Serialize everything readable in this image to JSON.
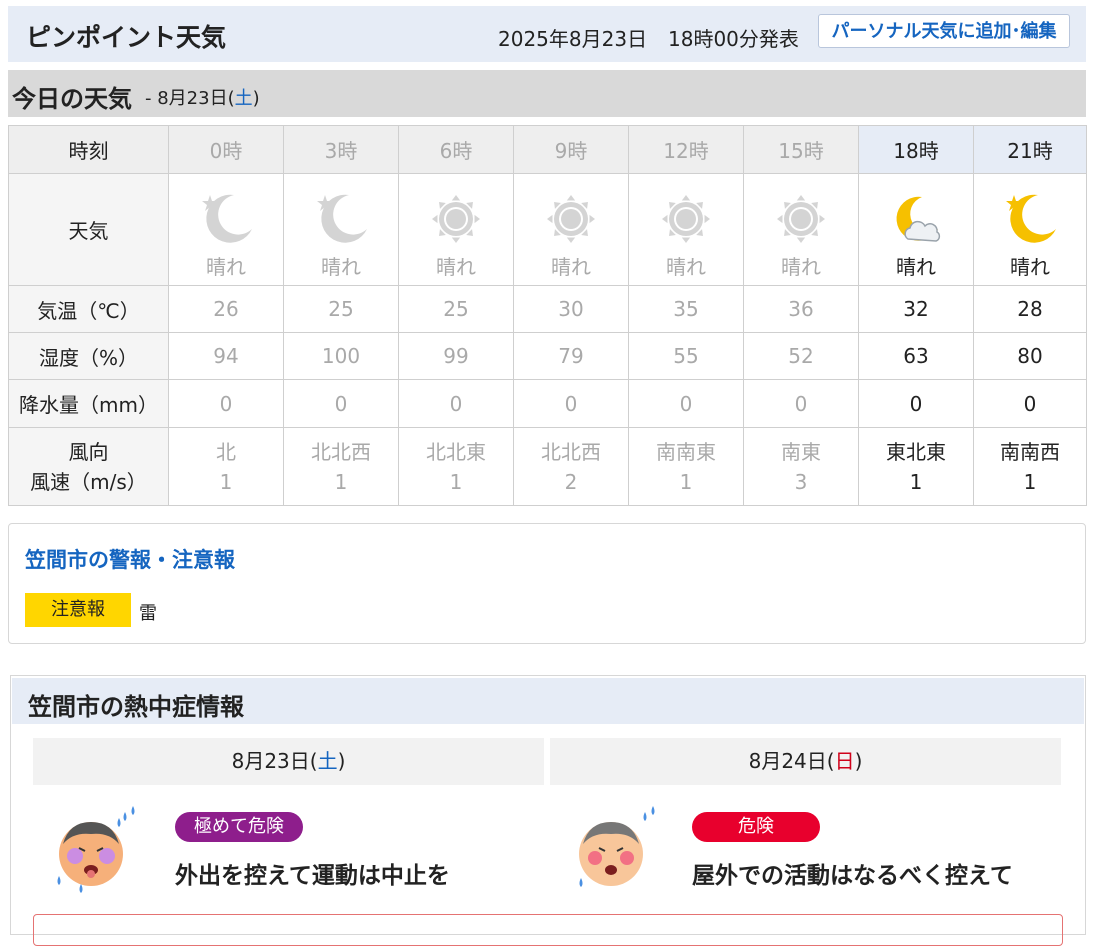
{
  "header": {
    "title": "ピンポイント天気",
    "issued_date": "2025年8月23日",
    "issued_time": "18時00分発表",
    "add_button": "パーソナル天気に追加･編集"
  },
  "today": {
    "title": "今日の天気",
    "date_prefix": "- 8月23日(",
    "weekday": "土",
    "date_suffix": ")"
  },
  "forecast": {
    "row_labels": {
      "time": "時刻",
      "weather": "天気",
      "temp": "気温（℃）",
      "humidity": "湿度（%）",
      "precip": "降水量（mm）",
      "wind_dir": "風向",
      "wind_speed": "風速（m/s）"
    },
    "hours": [
      {
        "time": "0時",
        "icon": "moon-star-icon",
        "weather": "晴れ",
        "temp": "26",
        "humidity": "94",
        "precip": "0",
        "wind_dir": "北",
        "wind_speed": "1",
        "past": true
      },
      {
        "time": "3時",
        "icon": "moon-star-icon",
        "weather": "晴れ",
        "temp": "25",
        "humidity": "100",
        "precip": "0",
        "wind_dir": "北北西",
        "wind_speed": "1",
        "past": true
      },
      {
        "time": "6時",
        "icon": "sun-icon",
        "weather": "晴れ",
        "temp": "25",
        "humidity": "99",
        "precip": "0",
        "wind_dir": "北北東",
        "wind_speed": "1",
        "past": true
      },
      {
        "time": "9時",
        "icon": "sun-icon",
        "weather": "晴れ",
        "temp": "30",
        "humidity": "79",
        "precip": "0",
        "wind_dir": "北北西",
        "wind_speed": "2",
        "past": true
      },
      {
        "time": "12時",
        "icon": "sun-icon",
        "weather": "晴れ",
        "temp": "35",
        "humidity": "55",
        "precip": "0",
        "wind_dir": "南南東",
        "wind_speed": "1",
        "past": true
      },
      {
        "time": "15時",
        "icon": "sun-icon",
        "weather": "晴れ",
        "temp": "36",
        "humidity": "52",
        "precip": "0",
        "wind_dir": "南東",
        "wind_speed": "3",
        "past": true
      },
      {
        "time": "18時",
        "icon": "moon-cloud-icon",
        "weather": "晴れ",
        "temp": "32",
        "humidity": "63",
        "precip": "0",
        "wind_dir": "東北東",
        "wind_speed": "1",
        "past": false
      },
      {
        "time": "21時",
        "icon": "moon-star-icon",
        "weather": "晴れ",
        "temp": "28",
        "humidity": "80",
        "precip": "0",
        "wind_dir": "南南西",
        "wind_speed": "1",
        "past": false
      }
    ]
  },
  "alerts": {
    "title": "笠間市の警報・注意報",
    "badge": "注意報",
    "kind": "雷",
    "badge_color": "#ffd600"
  },
  "heat": {
    "title": "笠間市の熱中症情報",
    "days": [
      {
        "date_prefix": "8月23日(",
        "weekday": "土",
        "date_suffix": ")",
        "level": "極めて危険",
        "level_color": "#8e1e8c",
        "message": "外出を控えて運動は中止を"
      },
      {
        "date_prefix": "8月24日(",
        "weekday": "日",
        "date_suffix": ")",
        "level": "危険",
        "level_color": "#e8002d",
        "message": "屋外での活動はなるべく控えて"
      }
    ]
  }
}
